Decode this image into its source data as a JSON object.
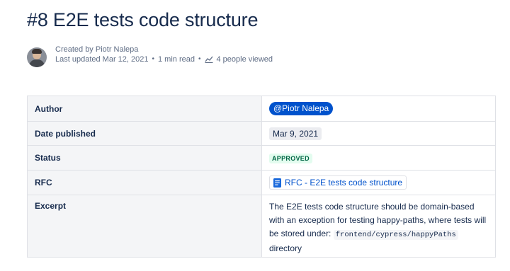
{
  "page": {
    "title": "#8 E2E tests code structure"
  },
  "byline": {
    "created_by": "Created by Piotr Nalepa",
    "last_updated": "Last updated Mar 12, 2021",
    "dot": "•",
    "read_time": "1 min read",
    "viewed": "4 people viewed"
  },
  "properties": {
    "author_label": "Author",
    "author_value": "@Piotr Nalepa",
    "date_label": "Date published",
    "date_value": "Mar 9, 2021",
    "status_label": "Status",
    "status_value": "APPROVED",
    "rfc_label": "RFC",
    "rfc_value": "RFC - E2E tests code structure",
    "excerpt_label": "Excerpt",
    "excerpt_text_1": "The E2E tests code structure should be domain-based with an exception for testing happy-paths, where tests will be stored under: ",
    "excerpt_code": "frontend/cypress/happyPaths",
    "excerpt_text_2": " directory"
  },
  "colors": {
    "mention_bg": "#0052cc",
    "status_bg": "#e3fcef",
    "status_text": "#006644",
    "link": "#0052cc"
  },
  "icons": {
    "avatar": "user-photo",
    "views": "chart-line-icon",
    "rfc": "document-icon"
  }
}
